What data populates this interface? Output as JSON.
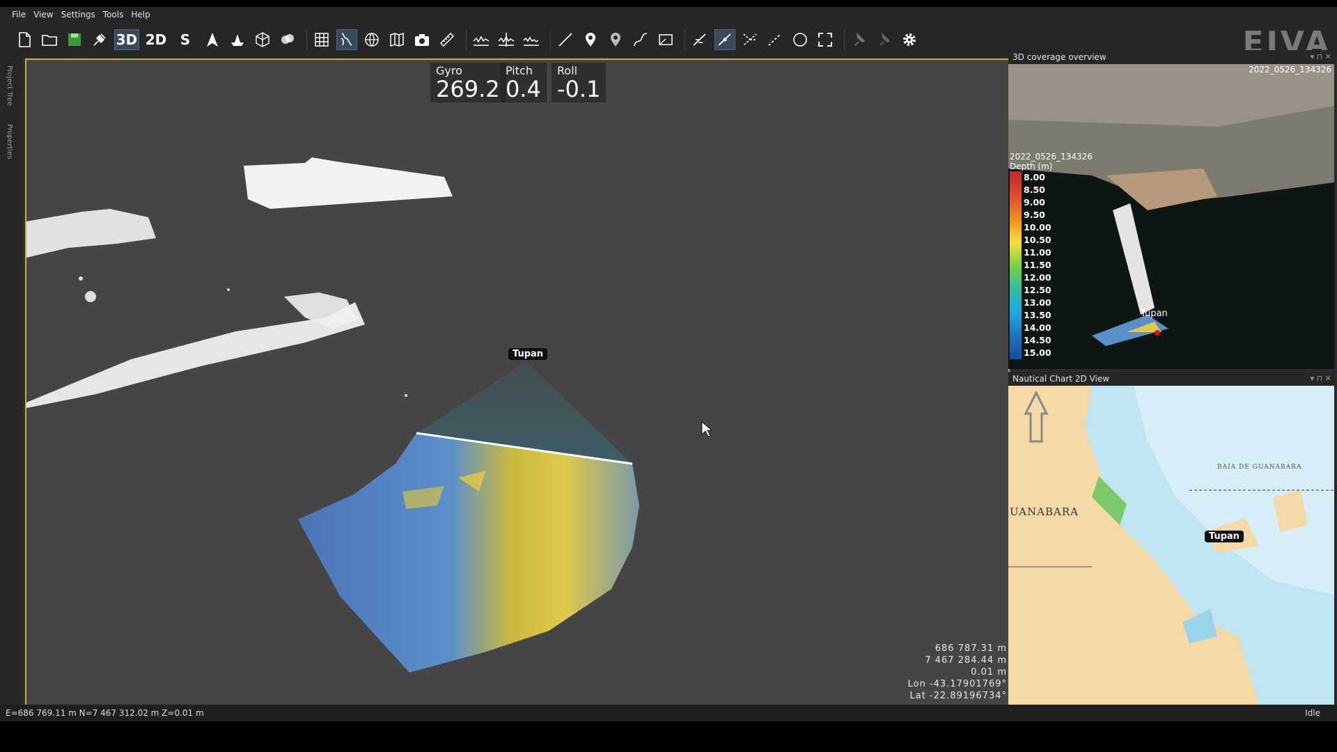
{
  "menu": [
    "File",
    "View",
    "Settings",
    "Tools",
    "Help"
  ],
  "toolbar": {
    "mode_3d": "3D",
    "mode_2d": "2D",
    "mode_s": "S"
  },
  "logo": "EIVA",
  "left_tabs": [
    "Project Tree",
    "Properties"
  ],
  "attitude": {
    "gyro": {
      "label": "Gyro",
      "value": "269.2"
    },
    "pitch": {
      "label": "Pitch",
      "value": "0.4"
    },
    "roll": {
      "label": "Roll",
      "value": "-0.1"
    }
  },
  "vessel_label": "Tupan",
  "coords": [
    "686 787.31 m",
    "7 467 284.44 m",
    "0.01 m",
    "Lon -43.17901769°",
    "Lat -22.89196734°"
  ],
  "coverage_panel": {
    "title": "3D coverage overview",
    "dataset_top": "2022_0526_134326",
    "dataset_legend": "2022_0526_134326",
    "legend_title": "Depth (m)",
    "depths": [
      "8.00",
      "8.50",
      "9.00",
      "9.50",
      "10.00",
      "10.50",
      "11.00",
      "11.50",
      "12.00",
      "12.50",
      "13.00",
      "13.50",
      "14.00",
      "14.50",
      "15.00"
    ]
  },
  "chart_panel": {
    "title": "Nautical Chart 2D View",
    "place_label": "UANABARA",
    "bay_label": "BAÍA DE GUANABARA"
  },
  "statusbar": {
    "position": "E=686 769.11 m N=7 467 312.02 m Z=0.01 m",
    "state": "Idle"
  },
  "colors": {
    "viewport_border": "#c9b23a",
    "accent": "#4c6a88"
  }
}
